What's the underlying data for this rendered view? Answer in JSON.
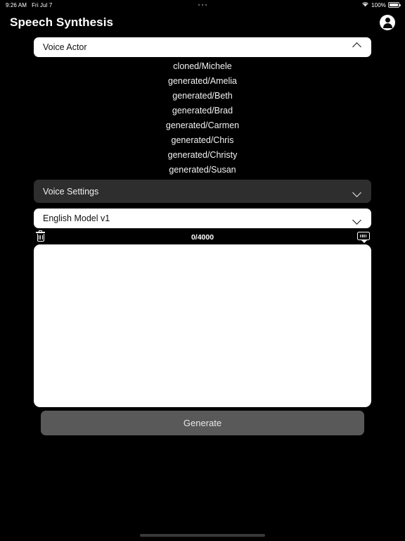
{
  "status_bar": {
    "time": "9:26 AM",
    "date": "Fri Jul 7",
    "wifi_icon": "wifi-icon",
    "battery_percent": "100%",
    "battery_icon": "battery-full-icon",
    "multitask_icon": "multitasking-dots-icon"
  },
  "header": {
    "title": "Speech Synthesis",
    "account_icon": "account-avatar-icon"
  },
  "voice_actor": {
    "label": "Voice Actor",
    "expanded": true,
    "chevron_icon": "chevron-up-icon",
    "options": [
      "cloned/Michele",
      "generated/Amelia",
      "generated/Beth",
      "generated/Brad",
      "generated/Carmen",
      "generated/Chris",
      "generated/Christy",
      "generated/Susan"
    ]
  },
  "voice_settings": {
    "label": "Voice Settings",
    "expanded": false,
    "chevron_icon": "chevron-down-icon"
  },
  "model": {
    "selected": "English Model v1",
    "chevron_icon": "chevron-down-icon"
  },
  "editor": {
    "clear_icon": "trash-icon",
    "counter": "0/4000",
    "dismiss_keyboard_icon": "hide-keyboard-icon",
    "text_value": "",
    "placeholder": ""
  },
  "actions": {
    "generate_label": "Generate"
  },
  "colors": {
    "background": "#000000",
    "field_white": "#ffffff",
    "field_dark": "#2e2e2e",
    "generate_button": "#595959",
    "text_light": "#f2f2f2"
  }
}
